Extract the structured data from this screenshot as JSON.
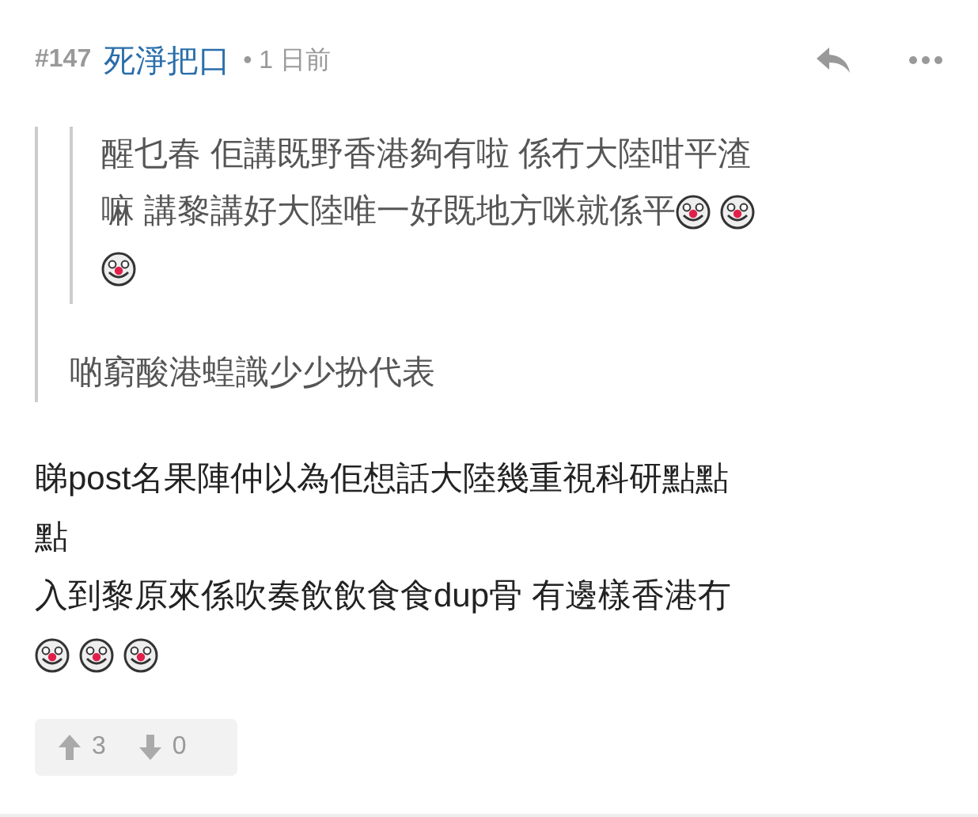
{
  "post": {
    "number": "#147",
    "author": "死淨把口",
    "separator": "•",
    "time": "1 日前"
  },
  "quote": {
    "inner": [
      [
        {
          "kind": "text",
          "text": "醒乜春 佢講既野香港夠有啦 係冇大陸咁平渣"
        }
      ],
      [
        {
          "kind": "text",
          "text": "嘛 講黎講好大陸唯一好既地方咪就係平"
        },
        {
          "kind": "emoji"
        },
        {
          "kind": "emoji"
        }
      ],
      [
        {
          "kind": "emoji"
        }
      ]
    ],
    "text": "啲窮酸港蝗識少少扮代表"
  },
  "body": [
    [
      {
        "kind": "text",
        "text": "睇post名果陣仲以為佢想話大陸幾重視科研點點"
      }
    ],
    [
      {
        "kind": "text",
        "text": "點"
      }
    ],
    [
      {
        "kind": "text",
        "text": "入到黎原來係吹奏飲飲食食dup骨 有邊樣香港冇"
      }
    ],
    [
      {
        "kind": "emoji"
      },
      {
        "kind": "emoji"
      },
      {
        "kind": "emoji"
      }
    ]
  ],
  "votes": {
    "up": "3",
    "down": "0"
  }
}
